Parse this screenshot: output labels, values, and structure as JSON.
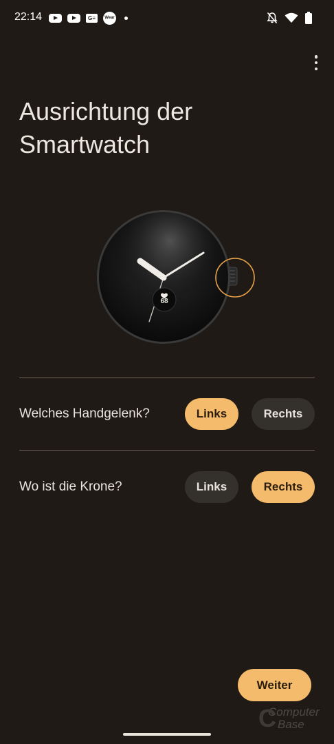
{
  "status_bar": {
    "time": "22:14",
    "gb_icon_text": "G≡",
    "wear_icon_text": "Wear"
  },
  "page": {
    "title": "Ausrichtung der Smartwatch",
    "watch_complication_value": "68"
  },
  "wrist_row": {
    "question": "Welches Handgelenk?",
    "option_left": "Links",
    "option_right": "Rechts",
    "selected": "Links"
  },
  "crown_row": {
    "question": "Wo ist die Krone?",
    "option_left": "Links",
    "option_right": "Rechts",
    "selected": "Rechts"
  },
  "footer": {
    "next_label": "Weiter"
  },
  "watermark": {
    "line1": "Computer",
    "line2": "Base"
  },
  "colors": {
    "background": "#1f1a15",
    "accent": "#f4bb6c",
    "pill_unselected": "#34302b",
    "highlight_ring": "#e8a349"
  }
}
